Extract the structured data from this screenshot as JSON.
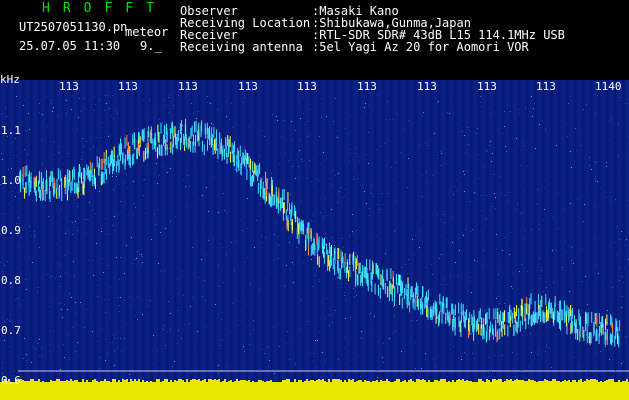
{
  "header": {
    "brand": "HROFFT",
    "filename": "UT2507051130.pn",
    "tag": "meteor",
    "datetime": "25.07.05 11:30",
    "count": "9._",
    "observer_label": "Observer",
    "observer_value": ":Masaki Kano",
    "location_label": "Receiving Location",
    "location_value": ":Shibukawa,Gunma,Japan",
    "receiver_label": "Receiver",
    "receiver_value": ":RTL-SDR SDR# 43dB L15 114.1MHz USB",
    "antenna_label": "Receiving antenna",
    "antenna_value": ":5el Yagi Az 20 for Aomori VOR"
  },
  "axis": {
    "unit": "kHz",
    "y_ticks": [
      "1.1",
      "1.0",
      "0.9",
      "0.8",
      "0.7",
      "0.6"
    ],
    "x_ticks": [
      "113",
      "113",
      "113",
      "113",
      "113",
      "113",
      "113",
      "113",
      "113",
      "1140"
    ]
  },
  "colors": {
    "background": "#0a2290",
    "trace_core": "#40e0ff",
    "trace_hot": "#ff8040",
    "trace_warm": "#ffff40",
    "bottom_band": "#e8e600",
    "brand": "#00e000"
  },
  "trace": {
    "x": [
      20,
      40,
      60,
      80,
      100,
      120,
      140,
      160,
      180,
      200,
      220,
      240,
      260,
      280,
      300,
      320,
      340,
      360,
      380,
      400,
      420,
      440,
      460,
      480,
      500,
      520,
      540,
      560,
      580,
      600,
      620
    ],
    "khz": [
      1.0,
      0.99,
      0.99,
      1.0,
      1.02,
      1.05,
      1.07,
      1.08,
      1.09,
      1.09,
      1.07,
      1.04,
      1.0,
      0.96,
      0.9,
      0.86,
      0.83,
      0.82,
      0.8,
      0.78,
      0.76,
      0.74,
      0.72,
      0.71,
      0.71,
      0.73,
      0.75,
      0.73,
      0.71,
      0.7,
      0.7
    ]
  }
}
